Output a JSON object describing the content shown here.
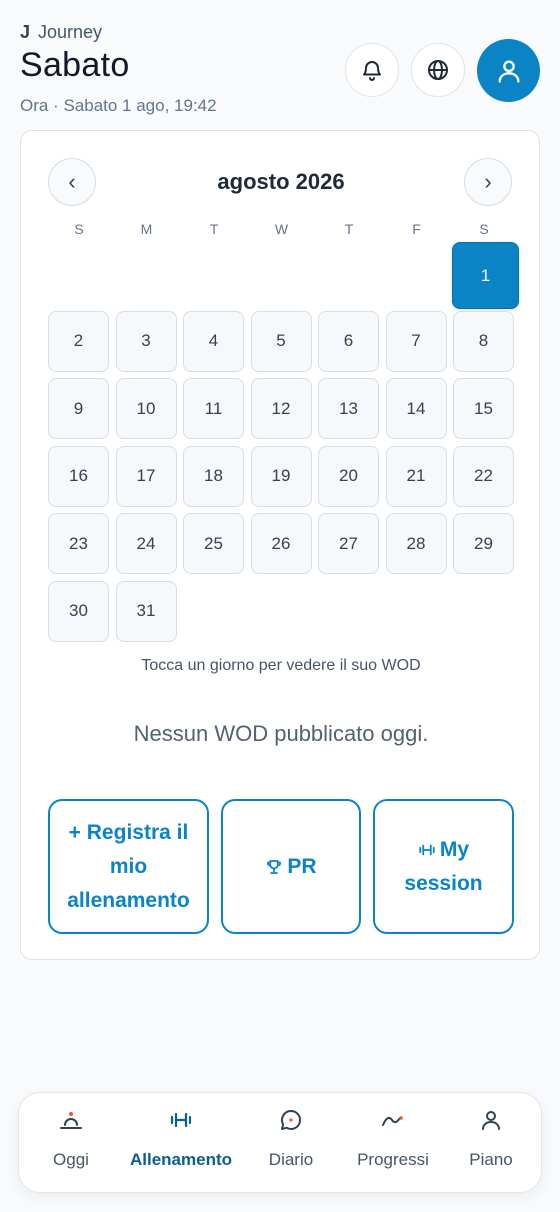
{
  "header": {
    "brand_letter": "J",
    "brand_name": "Journey",
    "title": "Sabato",
    "subtitle": "Ora · Sabato 1 ago, 19:42",
    "icons": [
      "bell-icon",
      "globe-icon",
      "user-icon"
    ]
  },
  "calendar": {
    "month_label": "agosto 2026",
    "prev_label": "‹",
    "next_label": "›",
    "weekdays": [
      "S",
      "M",
      "T",
      "W",
      "T",
      "F",
      "S"
    ],
    "days": [
      "1",
      "2",
      "3",
      "4",
      "5",
      "6",
      "7",
      "8",
      "9",
      "10",
      "11",
      "12",
      "13",
      "14",
      "15",
      "16",
      "17",
      "18",
      "19",
      "20",
      "21",
      "22",
      "23",
      "24",
      "25",
      "26",
      "27",
      "28",
      "29",
      "30",
      "31"
    ],
    "selected_day": "1",
    "hint": "Tocca un giorno per vedere il suo WOD"
  },
  "wod": {
    "empty_message": "Nessun WOD pubblicato oggi."
  },
  "actions": {
    "log_label": "+ Registra il mio allenamento",
    "pr_label": "PR",
    "session_label": "My session"
  },
  "bottom_nav": {
    "tabs": [
      {
        "label": "Oggi",
        "icon": "sunrise-icon"
      },
      {
        "label": "Allenamento",
        "icon": "dumbbell-icon",
        "active": true
      },
      {
        "label": "Diario",
        "icon": "chat-bubble-icon"
      },
      {
        "label": "Progressi",
        "icon": "trend-line-icon"
      },
      {
        "label": "Piano",
        "icon": "user-icon"
      }
    ]
  },
  "colors": {
    "accent": "#0b84c6",
    "active_tab": "#0b5e8f",
    "accent_warm": "#e8553a"
  }
}
